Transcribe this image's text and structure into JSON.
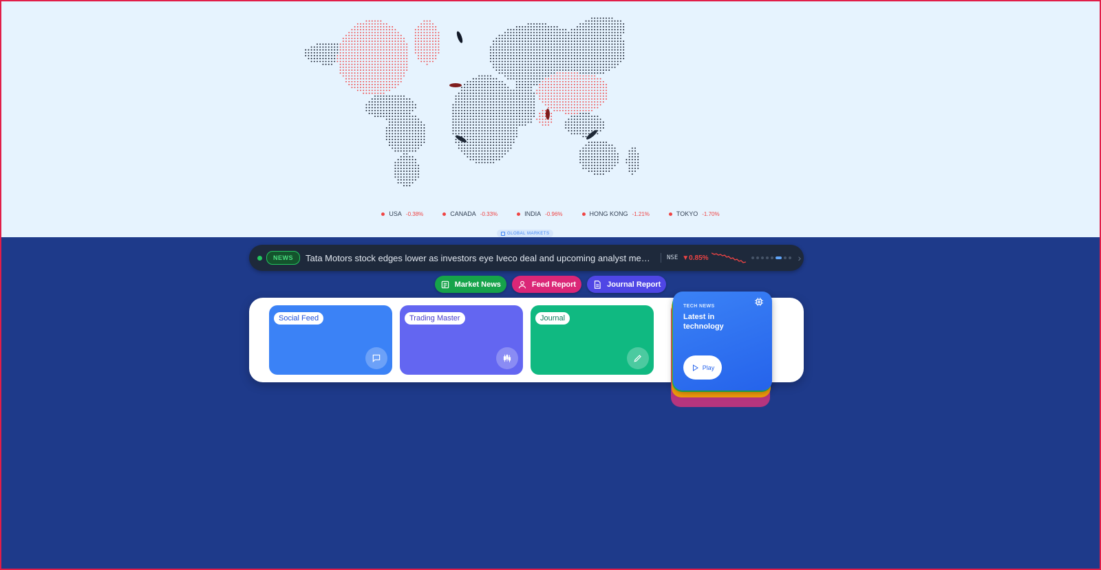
{
  "markets": [
    {
      "name": "USA",
      "change": "-0.38%"
    },
    {
      "name": "CANADA",
      "change": "-0.33%"
    },
    {
      "name": "INDIA",
      "change": "-0.96%"
    },
    {
      "name": "HONG KONG",
      "change": "-1.21%"
    },
    {
      "name": "TOKYO",
      "change": "-1.70%"
    }
  ],
  "global_label": "GLOBAL MARKETS",
  "ticker": {
    "badge": "NEWS",
    "headline": "Tata Motors stock edges lower as investors eye Iveco deal and upcoming analyst meet - ...",
    "exchange": "NSE",
    "change": "▼0.85%",
    "next_icon": "chevron-right-icon"
  },
  "tabs": [
    {
      "label": "Market News",
      "icon": "newspaper-icon"
    },
    {
      "label": "Feed Report",
      "icon": "user-icon"
    },
    {
      "label": "Journal Report",
      "icon": "document-icon"
    }
  ],
  "cards": [
    {
      "label": "Social Feed",
      "icon": "chat-icon"
    },
    {
      "label": "Trading Master",
      "icon": "candlestick-icon"
    },
    {
      "label": "Journal",
      "icon": "pencil-icon"
    }
  ],
  "tech_card": {
    "kicker": "TECH NEWS",
    "title": "Latest in technology",
    "play_label": "Play",
    "icon": "chip-icon"
  },
  "colors": {
    "top_bg": "#e6f3fe",
    "page_bg": "#1e3a8a",
    "negative": "#ef4444",
    "accent": "#2563eb"
  }
}
